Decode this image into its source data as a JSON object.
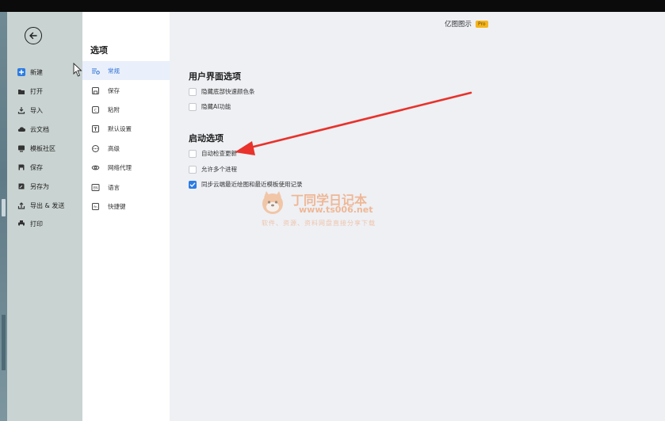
{
  "app": {
    "brand": "亿图图示",
    "badge": "Pro"
  },
  "sidebar": {
    "items": [
      {
        "label": "新建",
        "icon": "plus-square-icon",
        "active": true
      },
      {
        "label": "打开",
        "icon": "folder-icon"
      },
      {
        "label": "导入",
        "icon": "import-icon"
      },
      {
        "label": "云文档",
        "icon": "cloud-icon"
      },
      {
        "label": "模板社区",
        "icon": "template-icon"
      },
      {
        "label": "保存",
        "icon": "save-icon"
      },
      {
        "label": "另存为",
        "icon": "save-as-icon"
      },
      {
        "label": "导出 & 发送",
        "icon": "export-icon"
      },
      {
        "label": "打印",
        "icon": "print-icon"
      }
    ]
  },
  "options_nav": {
    "title": "选项",
    "items": [
      {
        "label": "常规",
        "icon": "general-icon",
        "active": true
      },
      {
        "label": "保存",
        "icon": "save-icon"
      },
      {
        "label": "粘附",
        "icon": "snap-icon"
      },
      {
        "label": "默认设置",
        "icon": "default-settings-icon"
      },
      {
        "label": "高级",
        "icon": "advanced-icon"
      },
      {
        "label": "网络代理",
        "icon": "proxy-icon"
      },
      {
        "label": "语言",
        "icon": "language-icon"
      },
      {
        "label": "快捷键",
        "icon": "shortcut-icon"
      }
    ]
  },
  "main": {
    "ui_section": {
      "title": "用户界面选项",
      "options": [
        {
          "label": "隐藏底部快速颜色条",
          "checked": false
        },
        {
          "label": "隐藏AI功能",
          "checked": false
        }
      ]
    },
    "startup_section": {
      "title": "启动选项",
      "options": [
        {
          "label": "自动检查更新",
          "checked": false
        },
        {
          "label": "允许多个进程",
          "checked": false
        },
        {
          "label": "同步云端最近绘图和最近模板使用记录",
          "checked": true
        }
      ]
    }
  },
  "watermark": {
    "line1": "丁同学日记本",
    "line2": "www.ts006.net",
    "line3": "软件、资源、资料网盘直接分享下载"
  },
  "colors": {
    "accent": "#2b7be4",
    "annotation_arrow": "#e8322b",
    "badge": "#f6b51c"
  }
}
